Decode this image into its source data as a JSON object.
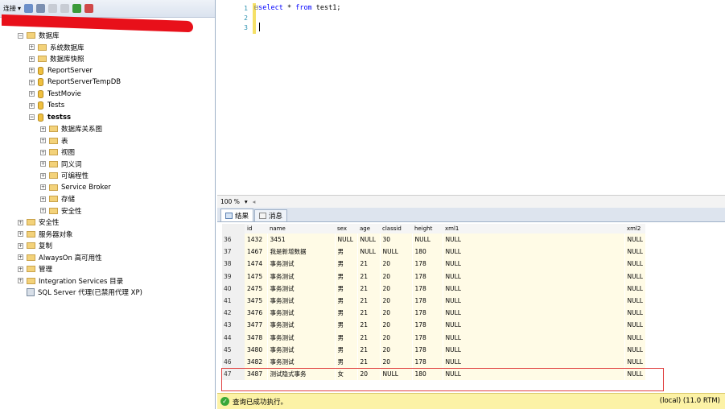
{
  "toolbar": {
    "connect_label": "连接"
  },
  "tree": [
    {
      "label": "数据库",
      "level": 1,
      "expanded": true,
      "icon": "folder"
    },
    {
      "label": "系统数据库",
      "level": 2,
      "icon": "folder"
    },
    {
      "label": "数据库快照",
      "level": 2,
      "icon": "folder"
    },
    {
      "label": "ReportServer",
      "level": 2,
      "icon": "database"
    },
    {
      "label": "ReportServerTempDB",
      "level": 2,
      "icon": "database"
    },
    {
      "label": "TestMovie",
      "level": 2,
      "icon": "database"
    },
    {
      "label": "Tests",
      "level": 2,
      "icon": "database"
    },
    {
      "label": "testss",
      "level": 2,
      "icon": "database",
      "expanded": true,
      "selected": true
    },
    {
      "label": "数据库关系图",
      "level": 3,
      "icon": "folder"
    },
    {
      "label": "表",
      "level": 3,
      "icon": "folder"
    },
    {
      "label": "视图",
      "level": 3,
      "icon": "folder"
    },
    {
      "label": "同义词",
      "level": 3,
      "icon": "folder"
    },
    {
      "label": "可编程性",
      "level": 3,
      "icon": "folder"
    },
    {
      "label": "Service Broker",
      "level": 3,
      "icon": "folder"
    },
    {
      "label": "存储",
      "level": 3,
      "icon": "folder"
    },
    {
      "label": "安全性",
      "level": 3,
      "icon": "folder"
    },
    {
      "label": "安全性",
      "level": 1,
      "icon": "folder"
    },
    {
      "label": "服务器对象",
      "level": 1,
      "icon": "folder"
    },
    {
      "label": "复制",
      "level": 1,
      "icon": "folder"
    },
    {
      "label": "AlwaysOn 高可用性",
      "level": 1,
      "icon": "folder"
    },
    {
      "label": "管理",
      "level": 1,
      "icon": "folder"
    },
    {
      "label": "Integration Services 目录",
      "level": 1,
      "icon": "folder"
    },
    {
      "label": "SQL Server 代理(已禁用代理 XP)",
      "level": 1,
      "icon": "agent",
      "noexp": true
    }
  ],
  "editor": {
    "lines": [
      "1",
      "2",
      "3"
    ],
    "code_kw1": "select",
    "code_mid": " * ",
    "code_kw2": "from",
    "code_end": " test1;"
  },
  "zoom": {
    "value": "100 %"
  },
  "tabs": {
    "results": "结果",
    "messages": "消息"
  },
  "grid": {
    "columns": [
      "id",
      "name",
      "sex",
      "age",
      "classid",
      "height",
      "xml1",
      "xml2"
    ],
    "rows": [
      [
        "36",
        "1432",
        "3451",
        "NULL",
        "NULL",
        "30",
        "NULL",
        "NULL",
        "NULL"
      ],
      [
        "37",
        "1467",
        "我是新增数据",
        "男",
        "NULL",
        "NULL",
        "180",
        "NULL",
        "NULL"
      ],
      [
        "38",
        "1474",
        "事务测试",
        "男",
        "21",
        "20",
        "178",
        "NULL",
        "NULL"
      ],
      [
        "39",
        "1475",
        "事务测试",
        "男",
        "21",
        "20",
        "178",
        "NULL",
        "NULL"
      ],
      [
        "40",
        "2475",
        "事务测试",
        "男",
        "21",
        "20",
        "178",
        "NULL",
        "NULL"
      ],
      [
        "41",
        "3475",
        "事务测试",
        "男",
        "21",
        "20",
        "178",
        "NULL",
        "NULL"
      ],
      [
        "42",
        "3476",
        "事务测试",
        "男",
        "21",
        "20",
        "178",
        "NULL",
        "NULL"
      ],
      [
        "43",
        "3477",
        "事务测试",
        "男",
        "21",
        "20",
        "178",
        "NULL",
        "NULL"
      ],
      [
        "44",
        "3478",
        "事务测试",
        "男",
        "21",
        "20",
        "178",
        "NULL",
        "NULL"
      ],
      [
        "45",
        "3480",
        "事务测试",
        "男",
        "21",
        "20",
        "178",
        "NULL",
        "NULL"
      ],
      [
        "46",
        "3482",
        "事务测试",
        "男",
        "21",
        "20",
        "178",
        "NULL",
        "NULL"
      ],
      [
        "47",
        "3487",
        "测试隐式事务",
        "女",
        "20",
        "NULL",
        "180",
        "NULL",
        "NULL"
      ]
    ]
  },
  "status": {
    "message": "查询已成功执行。",
    "server": "(local) (11.0 RTM)"
  }
}
